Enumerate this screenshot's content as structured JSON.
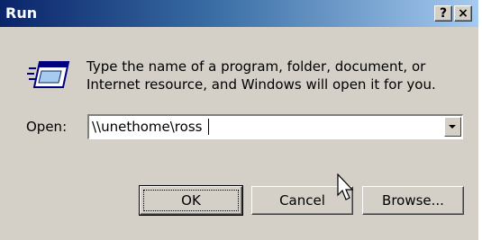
{
  "window": {
    "title": "Run",
    "help_label": "?",
    "close_label": "×"
  },
  "dialog": {
    "icon": "run-icon",
    "description_line1": "Type the name of a program, folder, document, or",
    "description_line2": "Internet resource, and Windows will open it for you.",
    "open_label": "Open:",
    "open_value": "\\\\unethome\\ross"
  },
  "buttons": {
    "ok_label": "OK",
    "cancel_label": "Cancel",
    "browse_label": "Browse..."
  },
  "colors": {
    "titlebar_start": "#0a246a",
    "titlebar_end": "#a6caf0",
    "face": "#d4d0c8"
  }
}
